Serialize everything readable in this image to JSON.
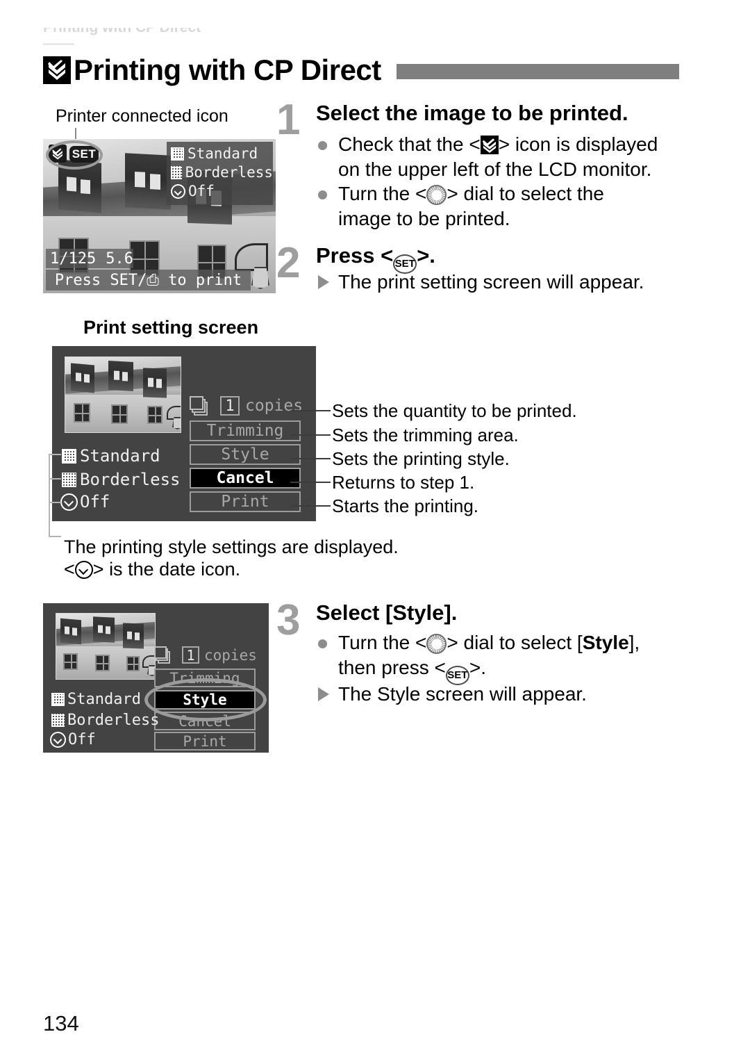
{
  "page": {
    "running_head": "Printing with CP Direct",
    "folio": "134"
  },
  "title": {
    "text": "Printing with CP Direct",
    "icon": "cp-direct-icon",
    "bar_color": "#7f7f7f"
  },
  "annotations": {
    "printer_connected_caption": "Printer connected icon"
  },
  "lcd_playback": {
    "icons": {
      "cp_direct": "cp-direct-icon",
      "set_badge": "SET"
    },
    "style_list": [
      {
        "icon": "checker-swatch-bordered-icon",
        "label": "Standard"
      },
      {
        "icon": "checker-swatch-icon",
        "label": "Borderless"
      },
      {
        "icon": "clock-date-icon",
        "label": "Off"
      }
    ],
    "exif": {
      "shutter": "1/125",
      "aperture": "5.6"
    },
    "hint": "Press SET/⎙ to print"
  },
  "print_setting_section": {
    "heading": "Print setting screen",
    "screen": {
      "copies": {
        "icon": "page-stack-icon",
        "value": "1",
        "unit": "copies"
      },
      "buttons": [
        {
          "label": "Trimming",
          "selected": false
        },
        {
          "label": "Style",
          "selected": false
        },
        {
          "label": "Cancel",
          "selected": true
        },
        {
          "label": "Print",
          "selected": false
        }
      ],
      "style_list": [
        {
          "icon": "checker-swatch-bordered-icon",
          "label": "Standard"
        },
        {
          "icon": "checker-swatch-icon",
          "label": "Borderless"
        },
        {
          "icon": "clock-date-icon",
          "label": "Off"
        }
      ]
    },
    "callouts": [
      "Sets the quantity to be printed.",
      "Sets the trimming area.",
      "Sets the printing style.",
      "Returns to step 1.",
      "Starts the printing."
    ],
    "notes": [
      "The printing style settings are displayed.",
      "is the date icon."
    ]
  },
  "steps": [
    {
      "number": "1",
      "title": "Select the image to be printed.",
      "bullets": [
        {
          "marker": "dot",
          "lines": [
            "Check that the <▣> icon is displayed",
            "on the upper left of the LCD monitor."
          ]
        },
        {
          "marker": "dot",
          "lines": [
            "Turn the <dial> dial to select the",
            "image to be printed."
          ]
        }
      ]
    },
    {
      "number": "2",
      "title": "Press <SET>.",
      "bullets": [
        {
          "marker": "triangle",
          "lines": [
            "The print setting screen will appear."
          ]
        }
      ]
    },
    {
      "number": "3",
      "title": "Select [Style].",
      "bullets": [
        {
          "marker": "dot",
          "lines": [
            "Turn the <dial> dial to select [Style],",
            "then press <SET>."
          ]
        },
        {
          "marker": "triangle",
          "lines": [
            "The Style screen will appear."
          ]
        }
      ]
    }
  ],
  "step_text": {
    "s1_title": "Select the image to be printed.",
    "s1_b1_pre": "Check that the <",
    "s1_b1_post": "> icon is displayed",
    "s1_b1_l2": "on the upper left of the LCD monitor.",
    "s1_b2_pre": "Turn the <",
    "s1_b2_post": "> dial to select the",
    "s1_b2_l2": "image to be printed.",
    "s2_title_pre": "Press <",
    "s2_title_post": ">.",
    "s2_b1": "The print setting screen will appear.",
    "s3_title": "Select [Style].",
    "s3_b1_pre": "Turn the <",
    "s3_b1_mid": "> dial to select [",
    "s3_b1_style": "Style",
    "s3_b1_post": "],",
    "s3_b1_l2_pre": "then press <",
    "s3_b1_l2_post": ">.",
    "s3_b2": "The Style screen will appear."
  },
  "style_screen": {
    "copies": {
      "value": "1",
      "unit": "copies"
    },
    "buttons": [
      {
        "label": "Trimming",
        "selected": false
      },
      {
        "label": "Style",
        "selected": true
      },
      {
        "label": "Cancel",
        "selected": false
      },
      {
        "label": "Print",
        "selected": false
      }
    ],
    "style_list": [
      {
        "icon": "checker-swatch-bordered-icon",
        "label": "Standard"
      },
      {
        "icon": "checker-swatch-icon",
        "label": "Borderless"
      },
      {
        "icon": "clock-date-icon",
        "label": "Off"
      }
    ]
  },
  "colors": {
    "lcd_bg": "#434343",
    "title_bar": "#7f7f7f",
    "step_number": "#9e9e9e",
    "bullet": "#8d8d8d",
    "selected_bg": "#000000"
  }
}
